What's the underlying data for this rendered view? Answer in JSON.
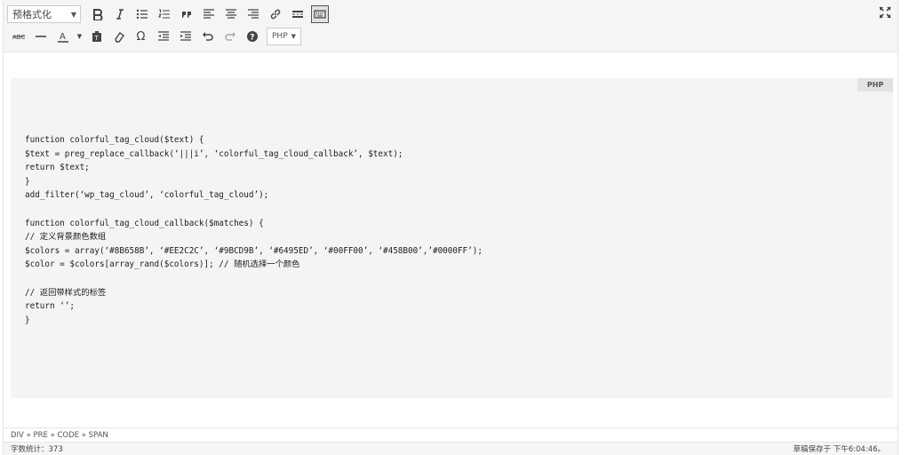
{
  "toolbar": {
    "format_select": "预格式化",
    "row1_icons": [
      "bold-icon",
      "italic-icon",
      "bullet-list-icon",
      "numbered-list-icon",
      "blockquote-icon",
      "align-left-icon",
      "align-center-icon",
      "align-right-icon",
      "link-icon",
      "read-more-icon",
      "toolbar-toggle-icon"
    ],
    "row2_icons": [
      "strikethrough-icon",
      "horizontal-rule-icon",
      "text-color-icon",
      "paste-as-text-icon",
      "clear-formatting-icon",
      "special-character-icon",
      "outdent-icon",
      "indent-icon",
      "undo-icon",
      "redo-icon",
      "help-icon"
    ],
    "language_select": "PHP"
  },
  "code_block": {
    "language_badge": "PHP",
    "lines": [
      "function colorful_tag_cloud($text) {",
      "$text = preg_replace_callback(‘|||i’, ‘colorful_tag_cloud_callback’, $text);",
      "return $text;",
      "}",
      "add_filter(‘wp_tag_cloud’, ‘colorful_tag_cloud’);",
      "",
      "function colorful_tag_cloud_callback($matches) {",
      "// 定义背景颜色数组",
      "$colors = array(‘#8B658B’, ‘#EE2C2C’, ‘#9BCD9B’, ‘#6495ED’, ‘#00FF00’, ‘#458B00’,’#0000FF’);",
      "$color = $colors[array_rand($colors)]; // 随机选择一个颜色",
      "",
      "// 返回带样式的标签",
      "return ‘’;",
      "}"
    ]
  },
  "path_bar": "DIV » PRE » CODE » SPAN",
  "status_bar": {
    "word_count": "字数统计：373",
    "draft_saved": "草稿保存于 下午6:04:46。"
  }
}
